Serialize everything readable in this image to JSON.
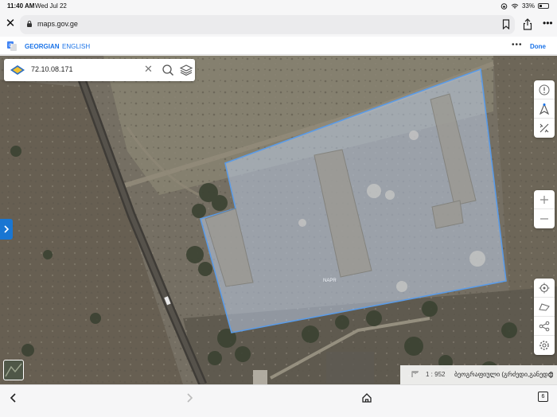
{
  "status_bar": {
    "time": "11:40 AM",
    "date": "Wed Jul 22",
    "battery": "33%"
  },
  "browser": {
    "url": "maps.gov.ge"
  },
  "translate_bar": {
    "source_lang": "GEORGIAN",
    "target_lang": "ENGLISH",
    "done_label": "Done"
  },
  "search": {
    "query": "72.10.08.171"
  },
  "map": {
    "scale": "1 : 952",
    "basemap_label": "ბეოგრაფიული (გრძედი,განედი)",
    "parcel_label": "NAPR"
  },
  "bottom_bar": {
    "tabs_count": "6"
  },
  "colors": {
    "accent": "#1a73e8",
    "sidebar_toggle": "#1976d2",
    "parcel_fill": "#b9cbe3",
    "parcel_stroke": "#4a90d9"
  }
}
